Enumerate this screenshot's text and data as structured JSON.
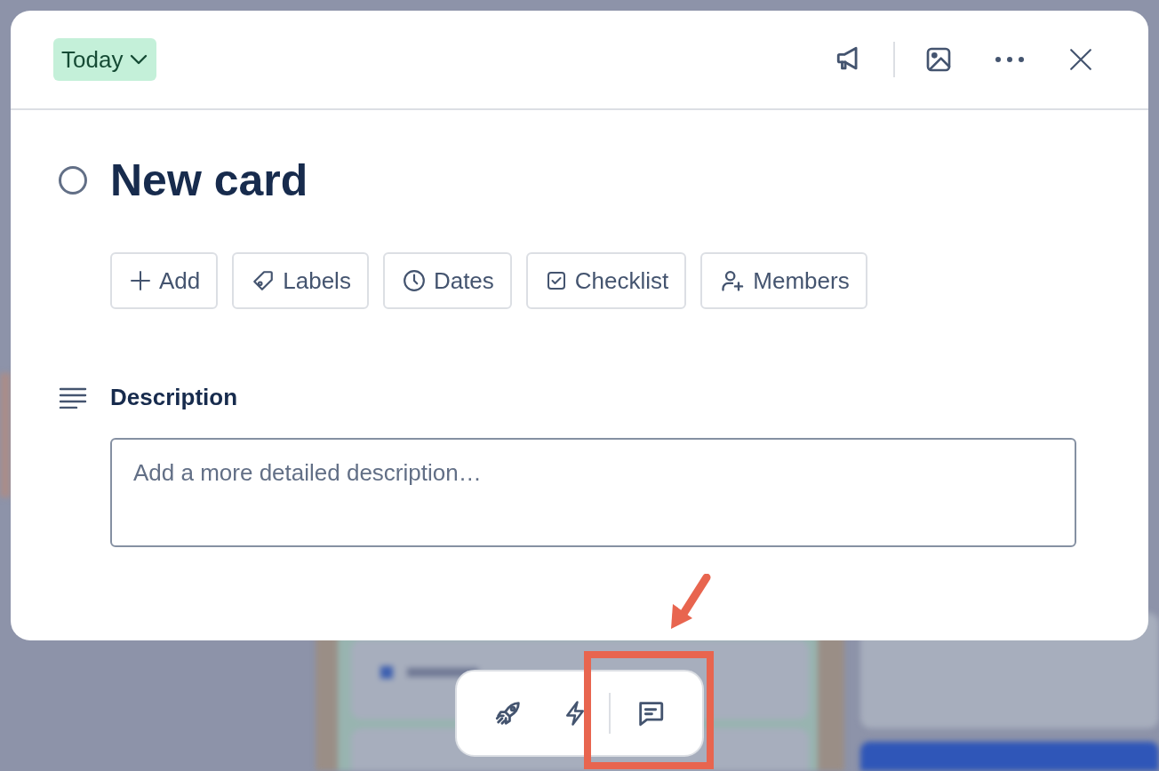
{
  "list_badge": {
    "label": "Today"
  },
  "card": {
    "title": "New card",
    "completed": false
  },
  "actions": [
    {
      "label": "Add",
      "kind": "plus"
    },
    {
      "label": "Labels",
      "kind": "tag"
    },
    {
      "label": "Dates",
      "kind": "clock"
    },
    {
      "label": "Checklist",
      "kind": "checkbox"
    },
    {
      "label": "Members",
      "kind": "person-add"
    }
  ],
  "description": {
    "heading": "Description",
    "placeholder": "Add a more detailed description…"
  },
  "quick_bar": {
    "buttons": [
      {
        "kind": "rocket",
        "highlighted": false
      },
      {
        "kind": "bolt",
        "highlighted": false
      },
      {
        "kind": "comment",
        "highlighted": true
      }
    ]
  }
}
